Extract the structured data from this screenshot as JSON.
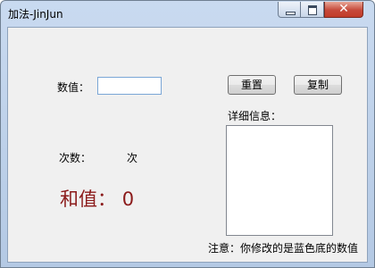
{
  "window": {
    "title": "加法-JinJun",
    "controls": {
      "minimize": "—",
      "maximize": "□",
      "close": "✕"
    }
  },
  "form": {
    "value_label": "数值：",
    "value_input": "",
    "reset_label": "重置",
    "copy_label": "复制",
    "details_label": "详细信息：",
    "count_label": "次数：",
    "count_unit": "次",
    "sum_label": "和值：",
    "sum_value": "0",
    "note": "注意：你修改的是蓝色底的数值"
  }
}
